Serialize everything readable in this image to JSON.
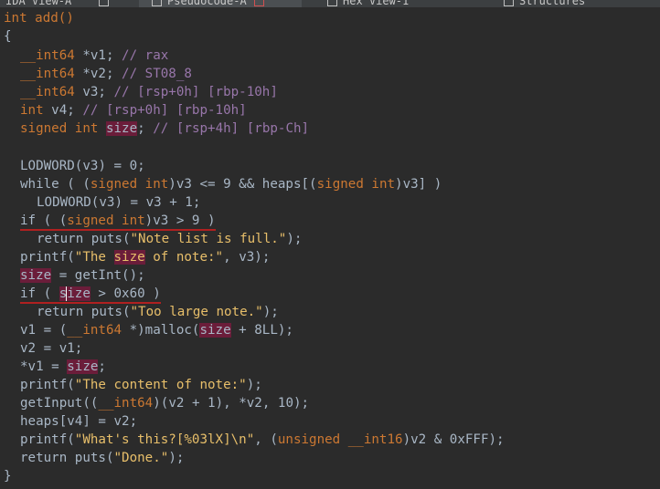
{
  "tabs": [
    {
      "label": "IDA View-A"
    },
    {
      "label": "Pseudocode-A"
    },
    {
      "label": "Hex View-1"
    },
    {
      "label": "Structures"
    }
  ],
  "code": {
    "l01": {
      "a": "int add()"
    },
    "l02": {
      "a": "{"
    },
    "l03": {
      "type": "__int64",
      "rest": " *v1; ",
      "cmt": "// rax"
    },
    "l04": {
      "type": "__int64",
      "rest": " *v2; ",
      "cmt": "// ST08_8"
    },
    "l05": {
      "type": "__int64",
      "rest": " v3; ",
      "cmt": "// [rsp+0h] [rbp-10h]"
    },
    "l06": {
      "type": "int",
      "rest": " v4; ",
      "cmt": "// [rsp+0h] [rbp-10h]"
    },
    "l07": {
      "type": "signed int",
      "sp": " ",
      "var": "size",
      "rest": "; ",
      "cmt": "// [rsp+4h] [rbp-Ch]"
    },
    "l08": {
      "a": ""
    },
    "l09": {
      "a": "LODWORD(",
      "b": "v3",
      "c": ") = 0;"
    },
    "l10": {
      "a": "while ( (",
      "t1": "signed int",
      "b": ")v3 <= 9 && ",
      "c": "heaps",
      "d": "[(",
      "t2": "signed int",
      "e": ")v3] )"
    },
    "l11": {
      "a": "LODWORD(",
      "b": "v3",
      "c": ") = v3 + 1;"
    },
    "l12": {
      "a": "if ( (",
      "t1": "signed int",
      "b": ")v3 > 9 )"
    },
    "l13": {
      "a": "return ",
      "fn": "puts",
      "b": "(",
      "s": "\"Note list is full.\"",
      "c": ");"
    },
    "l14": {
      "fn": "printf",
      "b": "(",
      "s1": "\"The ",
      "var": "size",
      "s2": " of note:\"",
      "c": ", v3);"
    },
    "l15": {
      "var": "size",
      "b": " = ",
      "fn": "getInt",
      "c": "();"
    },
    "l16": {
      "a": "if ( ",
      "v1": "s",
      "v2": "ize",
      "b": " > 0x60 )"
    },
    "l17": {
      "a": "return ",
      "fn": "puts",
      "b": "(",
      "s": "\"Too large note.\"",
      "c": ");"
    },
    "l18": {
      "a": "v1 = (",
      "type": "__int64",
      "b": " *)",
      "fn": "malloc",
      "c": "(",
      "var": "size",
      "d": " + 8LL);"
    },
    "l19": {
      "a": "v2 = v1;"
    },
    "l20": {
      "a": "*v1 = ",
      "var": "size",
      "b": ";"
    },
    "l21": {
      "fn": "printf",
      "b": "(",
      "s": "\"The content of note:\"",
      "c": ");"
    },
    "l22": {
      "fn": "getInput",
      "b": "((",
      "type": "__int64",
      "c": ")(v2 + 1), *v2, 10);"
    },
    "l23": {
      "a": "heaps",
      "b": "[v4] = v2;"
    },
    "l24": {
      "fn": "printf",
      "b": "(",
      "s": "\"What's this?[%03lX]\\n\"",
      "c": ", (",
      "type": "unsigned __int16",
      "d": ")v2 & 0xFFF);"
    },
    "l25": {
      "a": "return ",
      "fn": "puts",
      "b": "(",
      "s": "\"Done.\"",
      "c": ");"
    },
    "l26": {
      "a": "}"
    }
  },
  "colors": {
    "background": "#2b2b2b",
    "text": "#a9b7c6",
    "type": "#cc7832",
    "comment": "#9876aa",
    "string": "#e8bf6a",
    "highlight": "#6b1d3a"
  }
}
